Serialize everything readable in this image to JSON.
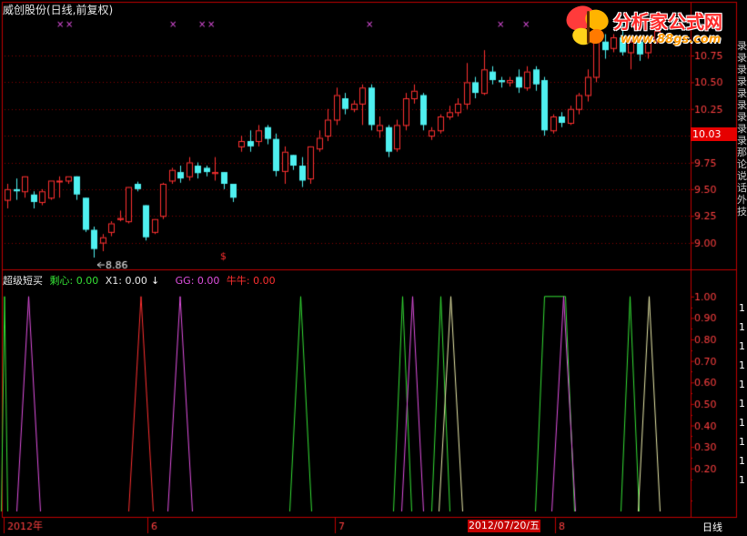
{
  "header": {
    "title": "威创股份(日线,前复权)"
  },
  "logo": {
    "name": "分析家公式网",
    "url": "www.88gs.com"
  },
  "price_panel": {
    "current_price_label": "10.03",
    "low_annotation": "8.86",
    "signal_marker": "$"
  },
  "indicator_panel": {
    "name": "超级短买",
    "lines": [
      {
        "label": "剩心: 0.00",
        "color": "#35e035"
      },
      {
        "label": "X1: 0.00",
        "color": "#e8e8e8"
      },
      {
        "label": "GG: 0.00",
        "color": "#e050e0"
      },
      {
        "label": "牛牛: 0.00",
        "color": "#ff3030"
      }
    ]
  },
  "right_strip_chars": [
    "录",
    "录",
    "录",
    "录",
    "录",
    "录",
    "录",
    "录",
    "录",
    "那",
    "论",
    "说",
    "话",
    "外",
    "技"
  ],
  "right_strip_bottom": [
    "1",
    "1",
    "1",
    "1",
    "1",
    "1",
    "1",
    "1",
    "1",
    "1"
  ],
  "time_axis": {
    "labels": [
      "2012年",
      "6",
      "7",
      "8"
    ],
    "highlight_date": "2012/07/20/五",
    "period": "日线"
  },
  "colors": {
    "up": "#ff3030",
    "down": "#4ff0f0",
    "frame": "#c00000",
    "grid": "#8b0000",
    "axis_text": "#ff4040"
  },
  "chart_data": [
    {
      "type": "candlestick",
      "ylim": [
        8.75,
        11.15
      ],
      "ytick_labels": [
        "9.00",
        "9.25",
        "9.50",
        "9.75",
        "10.00",
        "10.25",
        "10.50",
        "10.75"
      ],
      "candles": [
        [
          9.4,
          9.55,
          9.5,
          9.32
        ],
        [
          9.5,
          9.6,
          9.48,
          9.4
        ],
        [
          9.48,
          9.62,
          9.62,
          9.42
        ],
        [
          9.45,
          9.48,
          9.38,
          9.32
        ],
        [
          9.38,
          9.5,
          9.48,
          9.35
        ],
        [
          9.42,
          9.56,
          9.58,
          9.4
        ],
        [
          9.58,
          9.62,
          9.58,
          9.42
        ],
        [
          9.58,
          9.6,
          9.62,
          9.55
        ],
        [
          9.62,
          9.62,
          9.45,
          9.4
        ],
        [
          9.42,
          9.42,
          9.12,
          9.1
        ],
        [
          9.12,
          9.15,
          8.94,
          8.86
        ],
        [
          9.0,
          9.08,
          9.05,
          8.92
        ],
        [
          9.1,
          9.2,
          9.18,
          9.06
        ],
        [
          9.22,
          9.3,
          9.23,
          9.2
        ],
        [
          9.2,
          9.52,
          9.52,
          9.18
        ],
        [
          9.55,
          9.57,
          9.5,
          9.48
        ],
        [
          9.35,
          9.35,
          9.05,
          9.02
        ],
        [
          9.1,
          9.22,
          9.22,
          9.08
        ],
        [
          9.25,
          9.56,
          9.55,
          9.22
        ],
        [
          9.58,
          9.7,
          9.68,
          9.55
        ],
        [
          9.66,
          9.72,
          9.6,
          9.56
        ],
        [
          9.62,
          9.8,
          9.75,
          9.58
        ],
        [
          9.72,
          9.75,
          9.65,
          9.6
        ],
        [
          9.7,
          9.72,
          9.66,
          9.62
        ],
        [
          9.65,
          9.8,
          9.66,
          9.58
        ],
        [
          9.66,
          9.66,
          9.55,
          9.5
        ],
        [
          9.55,
          9.55,
          9.42,
          9.38
        ],
        [
          9.9,
          10.0,
          9.95,
          9.85
        ],
        [
          9.95,
          10.05,
          9.9,
          9.85
        ],
        [
          9.95,
          10.1,
          10.05,
          9.9
        ],
        [
          10.08,
          10.1,
          9.97,
          9.92
        ],
        [
          9.97,
          10.02,
          9.67,
          9.62
        ],
        [
          9.67,
          9.9,
          9.85,
          9.55
        ],
        [
          9.82,
          9.82,
          9.72,
          9.68
        ],
        [
          9.72,
          9.8,
          9.58,
          9.52
        ],
        [
          9.6,
          9.9,
          9.9,
          9.55
        ],
        [
          9.88,
          10.05,
          9.98,
          9.85
        ],
        [
          10.0,
          10.25,
          10.15,
          9.95
        ],
        [
          10.15,
          10.45,
          10.38,
          10.1
        ],
        [
          10.35,
          10.4,
          10.25,
          10.2
        ],
        [
          10.25,
          10.33,
          10.3,
          10.22
        ],
        [
          10.3,
          10.48,
          10.45,
          10.1
        ],
        [
          10.45,
          10.48,
          10.1,
          10.05
        ],
        [
          10.05,
          10.18,
          10.1,
          9.98
        ],
        [
          10.08,
          10.1,
          9.85,
          9.8
        ],
        [
          9.88,
          10.15,
          10.1,
          9.85
        ],
        [
          10.1,
          10.4,
          10.35,
          10.05
        ],
        [
          10.35,
          10.48,
          10.42,
          10.3
        ],
        [
          10.38,
          10.4,
          10.1,
          10.05
        ],
        [
          10.0,
          10.08,
          10.05,
          9.96
        ],
        [
          10.05,
          10.2,
          10.18,
          10.02
        ],
        [
          10.18,
          10.28,
          10.22,
          10.15
        ],
        [
          10.22,
          10.35,
          10.3,
          10.18
        ],
        [
          10.3,
          10.68,
          10.5,
          10.25
        ],
        [
          10.5,
          10.55,
          10.4,
          10.35
        ],
        [
          10.4,
          10.8,
          10.62,
          10.38
        ],
        [
          10.6,
          10.65,
          10.52,
          10.48
        ],
        [
          10.52,
          10.55,
          10.5,
          10.45
        ],
        [
          10.5,
          10.55,
          10.52,
          10.46
        ],
        [
          10.55,
          10.62,
          10.45,
          10.4
        ],
        [
          10.45,
          10.65,
          10.6,
          10.42
        ],
        [
          10.62,
          10.65,
          10.48,
          10.42
        ],
        [
          10.52,
          10.55,
          10.05,
          10.0
        ],
        [
          10.05,
          10.2,
          10.18,
          10.02
        ],
        [
          10.18,
          10.22,
          10.12,
          10.08
        ],
        [
          10.12,
          10.28,
          10.25,
          10.1
        ],
        [
          10.25,
          10.4,
          10.38,
          10.2
        ],
        [
          10.38,
          10.62,
          10.55,
          10.32
        ],
        [
          10.55,
          11.0,
          10.88,
          10.5
        ],
        [
          10.88,
          10.95,
          10.8,
          10.72
        ],
        [
          10.82,
          10.95,
          10.92,
          10.78
        ],
        [
          10.92,
          11.05,
          10.78,
          10.75
        ],
        [
          10.78,
          10.92,
          10.88,
          10.62
        ],
        [
          10.88,
          10.9,
          10.76,
          10.7
        ],
        [
          10.78,
          10.92,
          10.9,
          10.72
        ],
        [
          10.9,
          11.05,
          10.98,
          10.86
        ]
      ]
    },
    {
      "type": "line",
      "ylim": [
        0,
        1.05
      ],
      "ytick_labels": [
        "0.20",
        "0.30",
        "0.40",
        "0.50",
        "0.60",
        "0.70",
        "0.80",
        "0.90",
        "1.00"
      ],
      "series": [
        {
          "color": "#35e035",
          "spikes": [
            [
              1,
              8
            ],
            [
              318,
              342
            ],
            [
              432,
              452
            ],
            [
              474,
              494
            ],
            [
              588,
              631
            ],
            [
              682,
              702
            ]
          ]
        },
        {
          "color": "#ff3030",
          "spikes": [
            [
              141,
              168
            ]
          ]
        },
        {
          "color": "#e050e0",
          "spikes": [
            [
              18,
              44
            ],
            [
              184,
              211
            ],
            [
              441,
              465
            ],
            [
              606,
              632
            ]
          ]
        },
        {
          "color": "#e8e8a8",
          "spikes": [
            [
              482,
              508
            ],
            [
              701,
              725
            ]
          ]
        }
      ]
    }
  ]
}
